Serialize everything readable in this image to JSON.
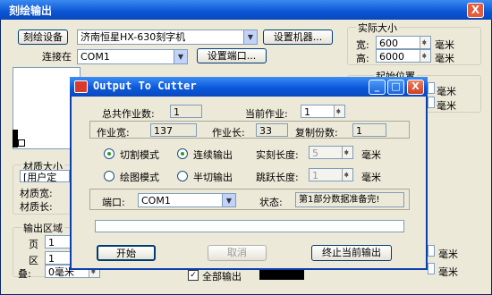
{
  "bg": {
    "title": "刻绘输出",
    "close_label": "X",
    "device_button": "刻绘设备",
    "device_value": "济南恒星HX-630刻字机",
    "setup_machine_button": "设置机器...",
    "connect_label": "连接在",
    "connect_value": "COM1",
    "setup_port_button": "设置端口...",
    "actual_size_title": "实际大小",
    "width_label": "宽:",
    "width_value": "600",
    "height_label": "高:",
    "height_value": "6000",
    "unit_mm": "毫米",
    "start_pos_title": "起始位置",
    "material_size_title": "材质大小",
    "material_user_value": "[用户定",
    "material_width_label": "材质宽:",
    "material_length_label": "材质长:",
    "output_area_title": "输出区域",
    "page_label": "页",
    "page_value": "1",
    "area_label": "区",
    "area_value": "1",
    "overlap_label": "叠:",
    "overlap_value": "0毫米",
    "all_output_label": "全部输出"
  },
  "dialog": {
    "title": "Output To Cutter",
    "min_label": "_",
    "max_label": "□",
    "close_label": "X",
    "total_jobs_label": "总共作业数:",
    "total_jobs_value": "1",
    "current_job_label": "当前作业:",
    "current_job_value": "1",
    "job_width_label": "作业宽:",
    "job_width_value": "137",
    "job_length_label": "作业长:",
    "job_length_value": "33",
    "copies_label": "复制份数:",
    "copies_value": "1",
    "mode_cut_label": "切割模式",
    "mode_continuous_label": "连续输出",
    "mode_plot_label": "绘图模式",
    "mode_half_cut_label": "半切输出",
    "actual_cut_length_label": "实刻长度:",
    "actual_cut_length_value": "5",
    "jump_length_label": "跳跃长度:",
    "jump_length_value": "1",
    "unit_mm": "毫米",
    "port_label": "端口:",
    "port_value": "COM1",
    "status_label": "状态:",
    "status_value": "第1部分数据准备完!",
    "start_button": "开始",
    "cancel_button": "取消",
    "stop_button": "终止当前输出"
  }
}
